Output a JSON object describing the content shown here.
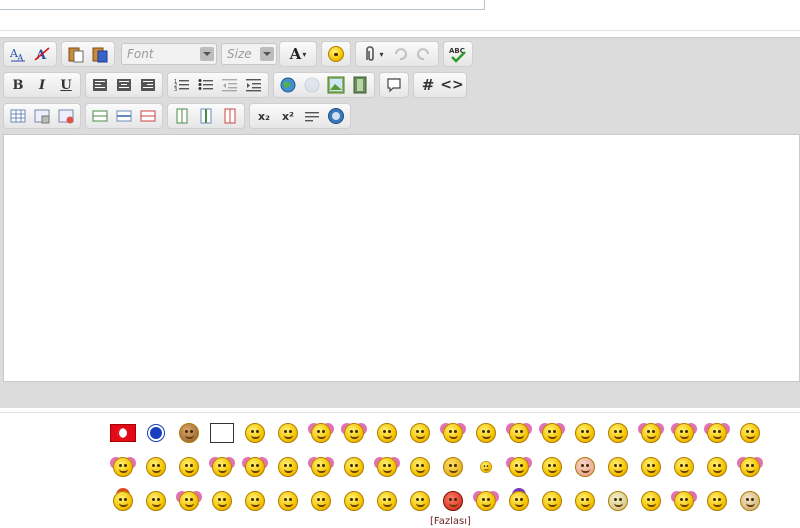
{
  "toolbar": {
    "font_placeholder": "Font",
    "size_placeholder": "Size",
    "font_color_letter": "A",
    "spell_check_label": "ABC",
    "source_label": "#",
    "code_label": "<>",
    "bold_label": "B",
    "italic_label": "I",
    "underline_label": "U",
    "subscript_label": "x₂",
    "superscript_label": "x²"
  },
  "smileys": {
    "more_label": "[Fazlası]",
    "rows": [
      [
        "flag-smiley",
        "evil-eye-smiley",
        "monkey-smiley",
        "sign-smiley",
        "smiley",
        "smiley",
        "smiley",
        "smiley",
        "smiley",
        "smiley",
        "smiley",
        "smiley",
        "smiley",
        "smiley",
        "smiley",
        "smiley",
        "smiley",
        "smiley",
        "smiley",
        "smiley"
      ],
      [
        "smiley",
        "smiley",
        "smiley",
        "smiley",
        "smiley",
        "smiley",
        "smiley",
        "smiley",
        "smiley",
        "smiley",
        "smiley",
        "smiley",
        "smiley",
        "smiley",
        "smiley",
        "smiley",
        "smiley",
        "smiley",
        "smiley",
        "smiley"
      ],
      [
        "smiley",
        "smiley",
        "smiley",
        "smiley",
        "smiley",
        "smiley",
        "smiley",
        "smiley",
        "smiley",
        "smiley",
        "smiley",
        "smiley",
        "smiley",
        "smiley",
        "smiley",
        "smiley",
        "smiley",
        "smiley",
        "smiley",
        "smiley"
      ]
    ]
  },
  "colors": {
    "toolbar_bg": "#dcdcdc",
    "link_color": "#6a1e1e"
  }
}
